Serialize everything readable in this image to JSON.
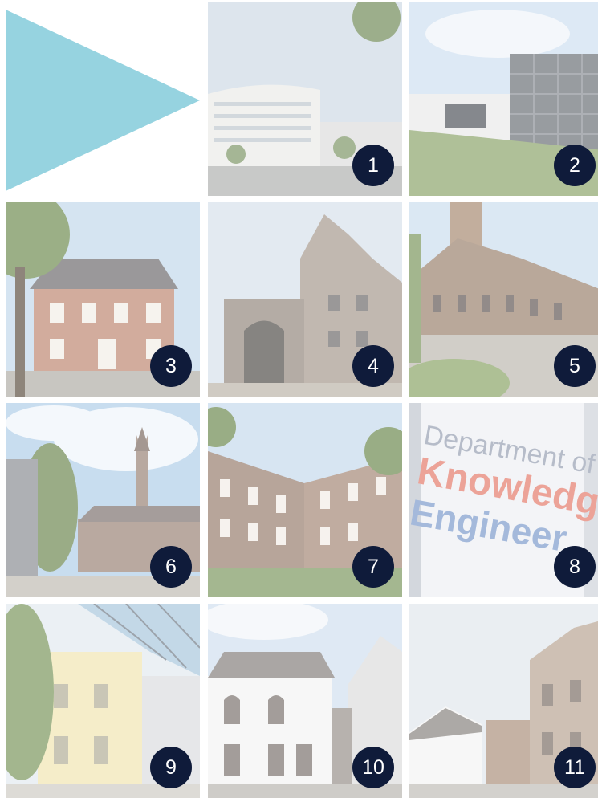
{
  "colors": {
    "arrow": "#96d3e0",
    "badge_bg": "#0f1b3a",
    "badge_text": "#ffffff"
  },
  "tiles": [
    {
      "label": "1",
      "subject": "curved white building"
    },
    {
      "label": "2",
      "subject": "glass tower on grass slope"
    },
    {
      "label": "3",
      "subject": "red brick villa with flags"
    },
    {
      "label": "4",
      "subject": "gabled gate and tower"
    },
    {
      "label": "5",
      "subject": "brick hall with tower and square"
    },
    {
      "label": "6",
      "subject": "church spire with trees"
    },
    {
      "label": "7",
      "subject": "brick courtyard with garden"
    },
    {
      "label": "8",
      "subject": "department sign"
    },
    {
      "label": "9",
      "subject": "atrium with glass roof"
    },
    {
      "label": "10",
      "subject": "white gabled house"
    },
    {
      "label": "11",
      "subject": "classical facade and street"
    }
  ],
  "sign": {
    "line1": "Department of",
    "line2": "Knowledge",
    "line3": "Engineer"
  }
}
